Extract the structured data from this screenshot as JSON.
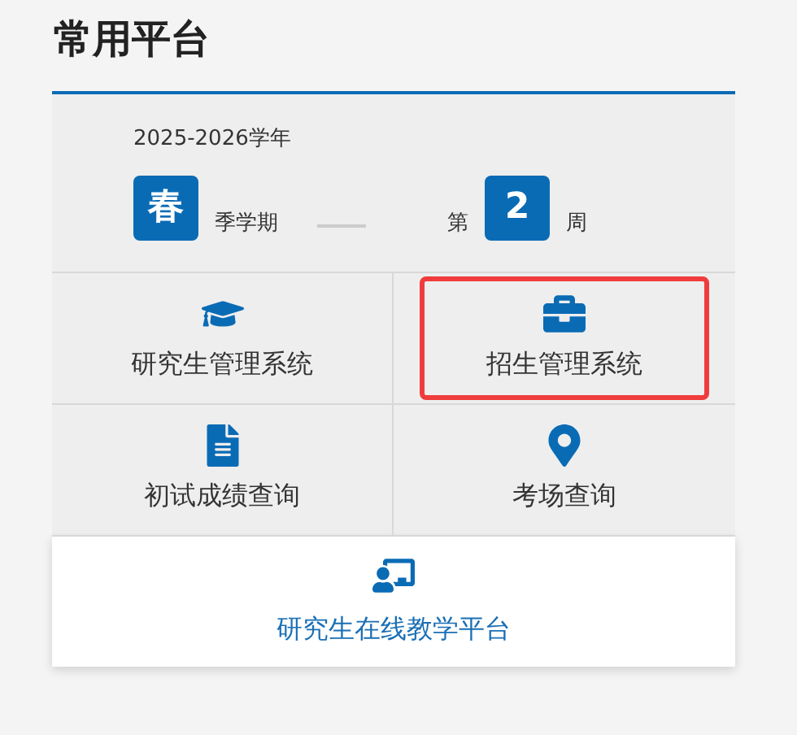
{
  "title": "常用平台",
  "semester": {
    "year": "2025-2026学年",
    "season": "春",
    "season_suffix": "季学期",
    "week_prefix": "第",
    "week": "2",
    "week_suffix": "周"
  },
  "tiles": [
    {
      "kind": "cap",
      "label": "研究生管理系统",
      "highlighted": false
    },
    {
      "kind": "briefcase",
      "label": "招生管理系统",
      "highlighted": true
    },
    {
      "kind": "document",
      "label": "初试成绩查询",
      "highlighted": false
    },
    {
      "kind": "pin",
      "label": "考场查询",
      "highlighted": false
    }
  ],
  "featured": {
    "kind": "teacher",
    "label": "研究生在线教学平台"
  }
}
